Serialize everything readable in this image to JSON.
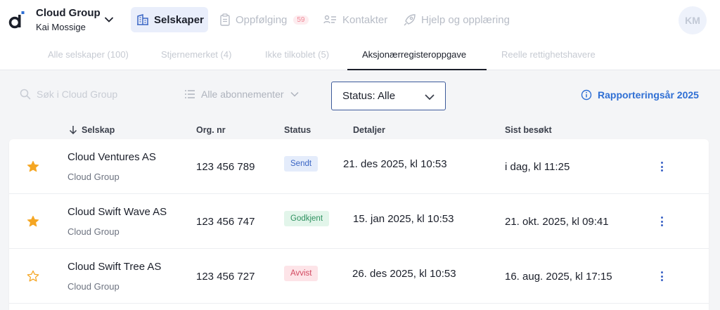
{
  "header": {
    "org_name": "Cloud Group",
    "user_name": "Kai Mossige",
    "nav": [
      {
        "label": "Selskaper",
        "icon": "building-icon",
        "active": true
      },
      {
        "label": "Oppfølging",
        "icon": "clipboard-icon",
        "badge": "59"
      },
      {
        "label": "Kontakter",
        "icon": "contacts-icon"
      },
      {
        "label": "Hjelp og opplæring",
        "icon": "rocket-icon"
      }
    ],
    "avatar_initials": "KM"
  },
  "subtabs": [
    "Alle selskaper (100)",
    "Stjernemerket (4)",
    "Ikke tilkoblet (5)",
    "Aksjonærregisteroppgave",
    "Reelle rettighetshavere"
  ],
  "active_subtab": "Aksjonærregisteroppgave",
  "filters": {
    "search_placeholder": "Søk i Cloud Group",
    "subscriptions": "Alle abonnementer",
    "status": "Status: Alle",
    "reporting_year": "Rapporteringsår 2025"
  },
  "table": {
    "columns": {
      "company": "Selskap",
      "orgnr": "Org. nr",
      "status": "Status",
      "details": "Detaljer",
      "last_visited": "Sist besøkt"
    },
    "rows": [
      {
        "starred": true,
        "name": "Cloud Ventures AS",
        "group": "Cloud Group",
        "orgnr": "123 456 789",
        "status": "Sendt",
        "details": "21. des 2025, kl 10:53",
        "last_visited": "i dag, kl 11:25"
      },
      {
        "starred": true,
        "name": "Cloud Swift Wave AS",
        "group": "Cloud Group",
        "orgnr": "123 456 747",
        "status": "Godkjent",
        "details": "15. jan 2025, kl 10:53",
        "last_visited": "21. okt. 2025, kl 09:41"
      },
      {
        "starred": false,
        "name": "Cloud Swift Tree AS",
        "group": "Cloud Group",
        "orgnr": "123 456 727",
        "status": "Avvist",
        "details": "26. des 2025, kl 10:53",
        "last_visited": "16. aug. 2025, kl 17:15"
      }
    ]
  },
  "colors": {
    "accent": "#2f6fd4",
    "star": "#f5a623",
    "status_sendt": "#3b66c4",
    "status_godkjent": "#2f9160",
    "status_avvist": "#d2485f"
  }
}
